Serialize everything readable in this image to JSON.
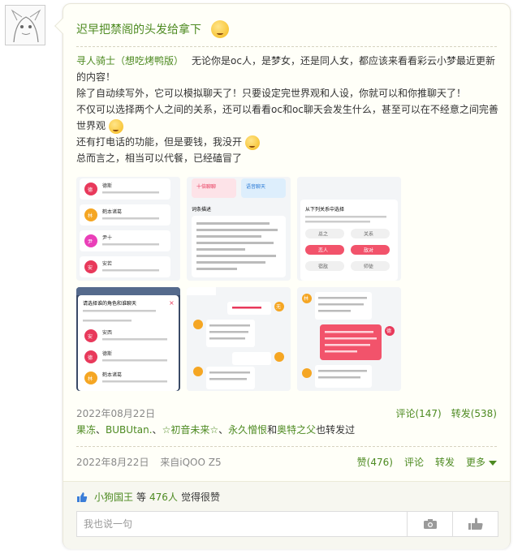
{
  "post": {
    "title": "迟早把禁阁的头发给拿下"
  },
  "repost": {
    "author": "寻人骑士（想吃烤鸭版）",
    "line1": "无论你是oc人，是梦女，还是同人女，都应该来看看彩云小梦最近更新的内容！",
    "line2": "除了自动续写外，它可以模拟聊天了！只要设定完世界观和人设，你就可以和你推聊天了！",
    "line3": "不仅可以选择两个人之间的关系，还可以看看oc和oc聊天会发生什么，甚至可以在不经意之间完善世界观",
    "line4": "还有打电话的功能，但是要钱，我没开",
    "line5": "总而言之，相当可以代餐，已经磕冒了"
  },
  "images": {
    "img1_items": [
      "德",
      "林",
      "尹",
      "安"
    ],
    "img1_colors": [
      "#e8395b",
      "#f5a623",
      "#ea3fb8",
      "#e8395b"
    ],
    "img1_names": [
      "德斯",
      "鹤本诸葛",
      "尹十",
      "安若"
    ],
    "img2_tabs": [
      "十倍聊聊",
      "语音聊天"
    ],
    "img2_heading": "词条描述",
    "img3_heading": "从下列关系中选择",
    "img3_tags": [
      "总之",
      "关系",
      "恋人",
      "敌对",
      "宿敌",
      "师徒"
    ],
    "img4_heading": "请选择谁的角色和谁聊天",
    "img4_items": [
      "安",
      "德",
      "林"
    ],
    "img4_names": [
      "安西",
      "德斯",
      "鹤本诸葛"
    ],
    "img5_badge": "无",
    "img6_badge": "德",
    "img6_avatar": "林"
  },
  "stats": {
    "date": "2022年08月22日",
    "comments": "评论(147)",
    "reposts": "转发(538)"
  },
  "also_reposted": {
    "users": [
      "果冻",
      "BUBUtan.",
      "☆初音未来☆",
      "永久憎恨",
      "奥特之父"
    ],
    "suffix": "也转发过"
  },
  "meta": {
    "date": "2022年8月22日",
    "source": "来自iQOO Z5",
    "likes": "赞(476)",
    "comment": "评论",
    "repost": "转发",
    "more": "更多"
  },
  "likes_bar": {
    "user": "小狗国王",
    "pre": "等",
    "count": "476人",
    "suffix": "觉得很赞"
  },
  "comment_box": {
    "placeholder": "我也说一句"
  },
  "colors": {
    "accent": "#4d8a21",
    "meta": "#888888"
  }
}
